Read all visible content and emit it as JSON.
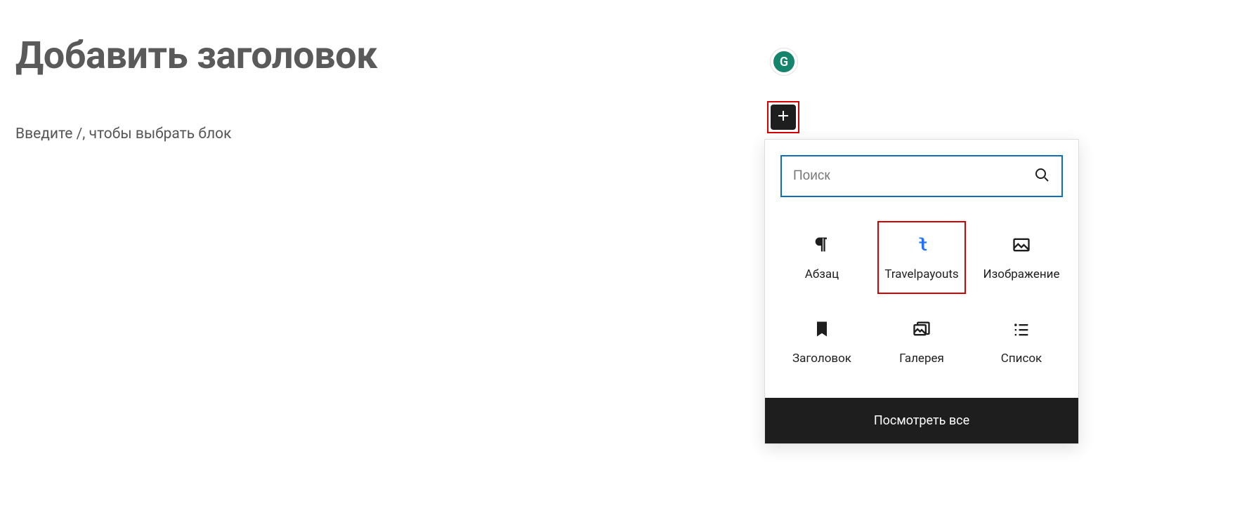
{
  "editor": {
    "title_placeholder": "Добавить заголовок",
    "body_placeholder": "Введите /, чтобы выбрать блок"
  },
  "grammarly": {
    "letter": "G"
  },
  "inserter": {
    "search_placeholder": "Поиск",
    "blocks": [
      {
        "label": "Абзац",
        "icon": "pilcrow",
        "highlighted": false
      },
      {
        "label": "Travelpayouts",
        "icon": "travelpayouts",
        "highlighted": true
      },
      {
        "label": "Изображение",
        "icon": "image",
        "highlighted": false
      },
      {
        "label": "Заголовок",
        "icon": "bookmark",
        "highlighted": false
      },
      {
        "label": "Галерея",
        "icon": "gallery",
        "highlighted": false
      },
      {
        "label": "Список",
        "icon": "list",
        "highlighted": false
      }
    ],
    "browse_all": "Посмотреть все"
  },
  "colors": {
    "highlight_border": "#d50000",
    "search_border": "#0f6fb8",
    "accent": "#2271ff",
    "dark": "#1e1e1e"
  }
}
